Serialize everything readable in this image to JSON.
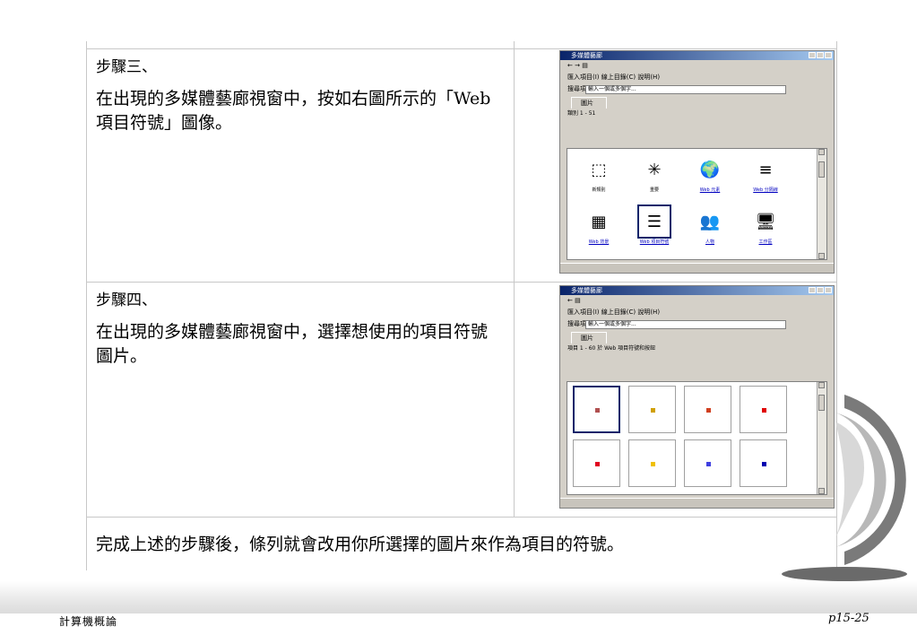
{
  "step3": {
    "title": "步驟三、",
    "text": "在出現的多媒體藝廊視窗中，按如右圖所示的「Web 項目符號」圖像。"
  },
  "step4": {
    "title": "步驟四、",
    "text": "在出現的多媒體藝廊視窗中，選擇想使用的項目符號圖片。"
  },
  "conclusion": "完成上述的步驟後，條列就會改用你所選擇的圖片來作為項目的符號。",
  "window1": {
    "title": "多媒體藝廊",
    "toolbar": "匯入項目(I)   線上目錄(C)   說明(H)",
    "search_label": "搜尋項目",
    "search_value": "輸入一個或多個字...",
    "tab": "圖片",
    "count": "類別 1 - 51",
    "clips": [
      {
        "label": "新類別",
        "icon": "new-category-icon",
        "symbol": "⬚"
      },
      {
        "label": "重要",
        "icon": "sparkle-icon",
        "symbol": "✳"
      },
      {
        "label": "Web 元素",
        "icon": "globe-icon",
        "symbol": "🌍"
      },
      {
        "label": "Web 分隔線",
        "icon": "divider-icon",
        "symbol": "≡"
      },
      {
        "label": "Web 背景",
        "icon": "pattern-icon",
        "symbol": "▦"
      },
      {
        "label": "Web 項目符號",
        "icon": "bullet-list-icon",
        "symbol": "☰"
      },
      {
        "label": "人物",
        "icon": "people-icon",
        "symbol": "👥"
      },
      {
        "label": "工作區",
        "icon": "workplace-icon",
        "symbol": "🖥"
      }
    ]
  },
  "window2": {
    "title": "多媒體藝廊",
    "toolbar": "匯入項目(I)   線上目錄(C)   說明(H)",
    "search_label": "搜尋項目",
    "search_value": "輸入一個或多個字...",
    "tab": "圖片",
    "count": "項目 1 - 60 於 Web 項目符號和按鈕",
    "bullet_colors": [
      "#b05050",
      "#d0a000",
      "#d04020",
      "#e00000",
      "#e00020",
      "#f0c000",
      "#4040e0",
      "#0000b0"
    ]
  },
  "footer": {
    "left": "計算機概論",
    "right": "p15-25"
  }
}
